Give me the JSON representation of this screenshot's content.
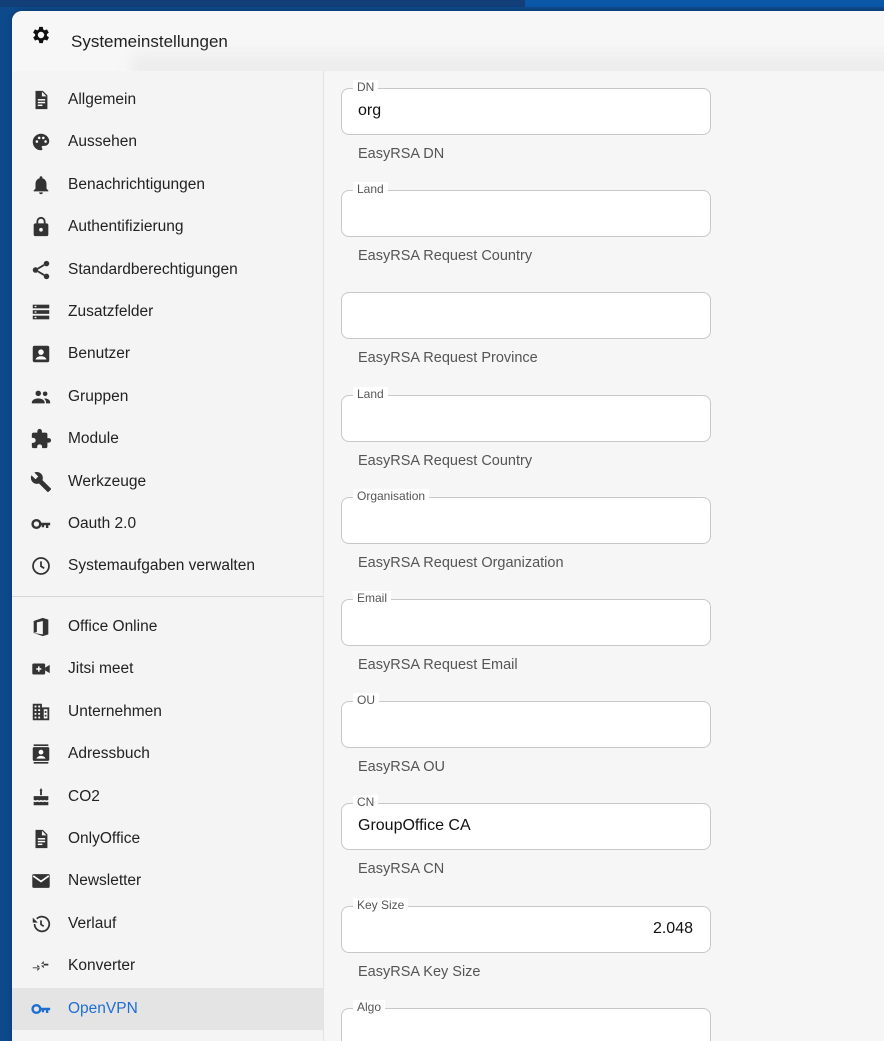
{
  "window": {
    "title": "Systemeinstellungen"
  },
  "sidebar": {
    "items": [
      {
        "label": "Allgemein",
        "icon": "document-icon"
      },
      {
        "label": "Aussehen",
        "icon": "palette-icon"
      },
      {
        "label": "Benachrichtigungen",
        "icon": "bell-icon"
      },
      {
        "label": "Authentifizierung",
        "icon": "lock-icon"
      },
      {
        "label": "Standardberechtigungen",
        "icon": "share-icon"
      },
      {
        "label": "Zusatzfelder",
        "icon": "storage-list-icon"
      },
      {
        "label": "Benutzer",
        "icon": "account-box-icon"
      },
      {
        "label": "Gruppen",
        "icon": "group-icon"
      },
      {
        "label": "Module",
        "icon": "puzzle-icon"
      },
      {
        "label": "Werkzeuge",
        "icon": "wrench-icon"
      },
      {
        "label": "Oauth 2.0",
        "icon": "key-icon"
      },
      {
        "label": "Systemaufgaben verwalten",
        "icon": "clock-icon"
      }
    ],
    "modules": [
      {
        "label": "Office Online",
        "icon": "office-icon"
      },
      {
        "label": "Jitsi meet",
        "icon": "video-camera-icon"
      },
      {
        "label": "Unternehmen",
        "icon": "building-icon"
      },
      {
        "label": "Adressbuch",
        "icon": "contacts-icon"
      },
      {
        "label": "CO2",
        "icon": "cake-icon"
      },
      {
        "label": "OnlyOffice",
        "icon": "document-icon"
      },
      {
        "label": "Newsletter",
        "icon": "mail-icon"
      },
      {
        "label": "Verlauf",
        "icon": "history-icon"
      },
      {
        "label": "Konverter",
        "icon": "swap-icon"
      },
      {
        "label": "OpenVPN",
        "icon": "key-icon",
        "active": true
      }
    ]
  },
  "form": {
    "fields": [
      {
        "label": "DN",
        "value": "org",
        "hint": "EasyRSA DN"
      },
      {
        "label": "Land",
        "value": "",
        "hint": "EasyRSA Request Country"
      },
      {
        "label": "",
        "value": "",
        "hint": "EasyRSA Request Province"
      },
      {
        "label": "Land",
        "value": "",
        "hint": "EasyRSA Request Country"
      },
      {
        "label": "Organisation",
        "value": "",
        "hint": "EasyRSA Request Organization"
      },
      {
        "label": "Email",
        "value": "",
        "hint": "EasyRSA Request Email"
      },
      {
        "label": "OU",
        "value": "",
        "hint": "EasyRSA OU"
      },
      {
        "label": "CN",
        "value": "GroupOffice CA",
        "hint": "EasyRSA CN"
      },
      {
        "label": "Key Size",
        "value": "2.048",
        "hint": "EasyRSA Key Size"
      },
      {
        "label": "Algo",
        "value": "",
        "hint": ""
      }
    ]
  },
  "colors": {
    "accent": "#1f6fd0",
    "desktop": "#0d4a8c"
  }
}
